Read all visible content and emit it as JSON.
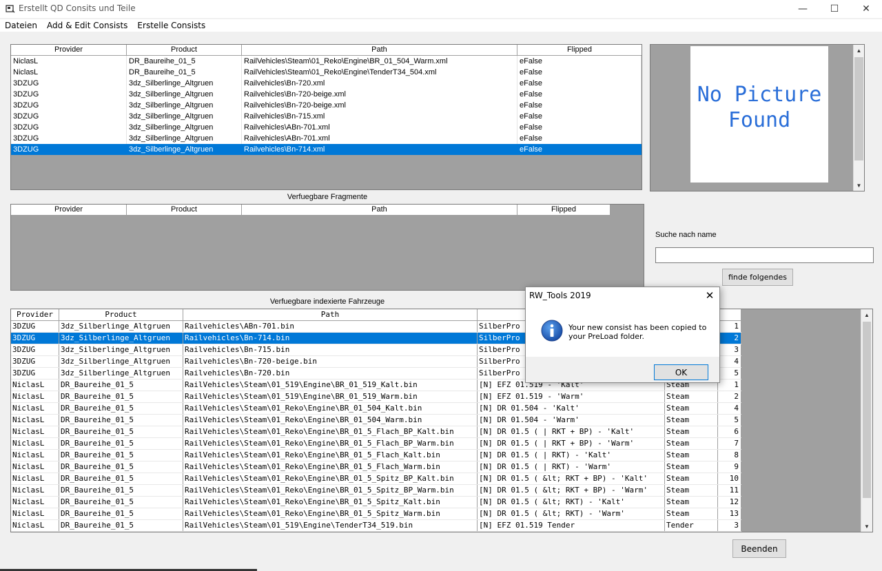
{
  "window": {
    "title": "Erstellt QD Consits und Teile",
    "minimize": "—",
    "maximize": "☐",
    "close": "✕"
  },
  "menu": [
    "Dateien",
    "Add & Edit Consists",
    "Erstelle Consists"
  ],
  "consist_table": {
    "headers": [
      "Provider",
      "Product",
      "Path",
      "Flipped"
    ],
    "rows": [
      [
        "NiclasL",
        "DR_Baureihe_01_5",
        "RailVehicles\\Steam\\01_Reko\\Engine\\BR_01_504_Warm.xml",
        "eFalse"
      ],
      [
        "NiclasL",
        "DR_Baureihe_01_5",
        "RailVehicles\\Steam\\01_Reko\\Engine\\TenderT34_504.xml",
        "eFalse"
      ],
      [
        "3DZUG",
        "3dz_Silberlinge_Altgruen",
        "Railvehicles\\Bn-720.xml",
        "eFalse"
      ],
      [
        "3DZUG",
        "3dz_Silberlinge_Altgruen",
        "Railvehicles\\Bn-720-beige.xml",
        "eFalse"
      ],
      [
        "3DZUG",
        "3dz_Silberlinge_Altgruen",
        "Railvehicles\\Bn-720-beige.xml",
        "eFalse"
      ],
      [
        "3DZUG",
        "3dz_Silberlinge_Altgruen",
        "Railvehicles\\Bn-715.xml",
        "eFalse"
      ],
      [
        "3DZUG",
        "3dz_Silberlinge_Altgruen",
        "Railvehicles\\ABn-701.xml",
        "eFalse"
      ],
      [
        "3DZUG",
        "3dz_Silberlinge_Altgruen",
        "Railvehicles\\ABn-701.xml",
        "eFalse"
      ],
      [
        "3DZUG",
        "3dz_Silberlinge_Altgruen",
        "Railvehicles\\Bn-714.xml",
        "eFalse"
      ]
    ],
    "selected_index": 8
  },
  "preview": {
    "line1": "No Picture",
    "line2": "Found"
  },
  "fragments": {
    "caption": "Verfuegbare Fragmente",
    "headers": [
      "Provider",
      "Product",
      "Path",
      "Flipped"
    ]
  },
  "search": {
    "label": "Suche nach name",
    "value": "",
    "button": "finde folgendes"
  },
  "vehicles": {
    "caption": "Verfuegbare indexierte Fahrzeuge",
    "headers": [
      "Provider",
      "Product",
      "Path"
    ],
    "rows": [
      [
        "3DZUG",
        "3dz_Silberlinge_Altgruen",
        "Railvehicles\\ABn-701.bin",
        "SilberPro",
        "",
        "1"
      ],
      [
        "3DZUG",
        "3dz_Silberlinge_Altgruen",
        "Railvehicles\\Bn-714.bin",
        "SilberPro",
        "",
        "2"
      ],
      [
        "3DZUG",
        "3dz_Silberlinge_Altgruen",
        "Railvehicles\\Bn-715.bin",
        "SilberPro",
        "",
        "3"
      ],
      [
        "3DZUG",
        "3dz_Silberlinge_Altgruen",
        "Railvehicles\\Bn-720-beige.bin",
        "SilberPro",
        "",
        "4"
      ],
      [
        "3DZUG",
        "3dz_Silberlinge_Altgruen",
        "Railvehicles\\Bn-720.bin",
        "SilberPro",
        "",
        "5"
      ],
      [
        "NiclasL",
        "DR_Baureihe_01_5",
        "RailVehicles\\Steam\\01_519\\Engine\\BR_01_519_Kalt.bin",
        "[N] EFZ 01.519 - 'Kalt'",
        "Steam",
        "1"
      ],
      [
        "NiclasL",
        "DR_Baureihe_01_5",
        "RailVehicles\\Steam\\01_519\\Engine\\BR_01_519_Warm.bin",
        "[N] EFZ 01.519 - 'Warm'",
        "Steam",
        "2"
      ],
      [
        "NiclasL",
        "DR_Baureihe_01_5",
        "RailVehicles\\Steam\\01_Reko\\Engine\\BR_01_504_Kalt.bin",
        "[N] DR 01.504 - 'Kalt'",
        "Steam",
        "4"
      ],
      [
        "NiclasL",
        "DR_Baureihe_01_5",
        "RailVehicles\\Steam\\01_Reko\\Engine\\BR_01_504_Warm.bin",
        "[N] DR 01.504 - 'Warm'",
        "Steam",
        "5"
      ],
      [
        "NiclasL",
        "DR_Baureihe_01_5",
        "RailVehicles\\Steam\\01_Reko\\Engine\\BR_01_5_Flach_BP_Kalt.bin",
        "[N] DR 01.5 ( | RKT + BP) - 'Kalt'",
        "Steam",
        "6"
      ],
      [
        "NiclasL",
        "DR_Baureihe_01_5",
        "RailVehicles\\Steam\\01_Reko\\Engine\\BR_01_5_Flach_BP_Warm.bin",
        "[N] DR 01.5 ( | RKT + BP) - 'Warm'",
        "Steam",
        "7"
      ],
      [
        "NiclasL",
        "DR_Baureihe_01_5",
        "RailVehicles\\Steam\\01_Reko\\Engine\\BR_01_5_Flach_Kalt.bin",
        "[N] DR 01.5 ( | RKT) - 'Kalt'",
        "Steam",
        "8"
      ],
      [
        "NiclasL",
        "DR_Baureihe_01_5",
        "RailVehicles\\Steam\\01_Reko\\Engine\\BR_01_5_Flach_Warm.bin",
        "[N] DR 01.5 ( | RKT) - 'Warm'",
        "Steam",
        "9"
      ],
      [
        "NiclasL",
        "DR_Baureihe_01_5",
        "RailVehicles\\Steam\\01_Reko\\Engine\\BR_01_5_Spitz_BP_Kalt.bin",
        "[N] DR 01.5 ( &lt; RKT + BP) - 'Kalt'",
        "Steam",
        "10"
      ],
      [
        "NiclasL",
        "DR_Baureihe_01_5",
        "RailVehicles\\Steam\\01_Reko\\Engine\\BR_01_5_Spitz_BP_Warm.bin",
        "[N] DR 01.5 ( &lt; RKT + BP) - 'Warm'",
        "Steam",
        "11"
      ],
      [
        "NiclasL",
        "DR_Baureihe_01_5",
        "RailVehicles\\Steam\\01_Reko\\Engine\\BR_01_5_Spitz_Kalt.bin",
        "[N] DR 01.5 ( &lt; RKT) - 'Kalt'",
        "Steam",
        "12"
      ],
      [
        "NiclasL",
        "DR_Baureihe_01_5",
        "RailVehicles\\Steam\\01_Reko\\Engine\\BR_01_5_Spitz_Warm.bin",
        "[N] DR 01.5 ( &lt; RKT) - 'Warm'",
        "Steam",
        "13"
      ],
      [
        "NiclasL",
        "DR_Baureihe_01_5",
        "RailVehicles\\Steam\\01_519\\Engine\\TenderT34_519.bin",
        "[N] EFZ 01.519 Tender",
        "Tender",
        "3"
      ]
    ],
    "selected_index": 1
  },
  "exit_button": "Beenden",
  "dialog": {
    "title": "RW_Tools 2019",
    "close": "✕",
    "message": "Your new consist has been copied to your PreLoad folder.",
    "ok": "OK"
  },
  "colors": {
    "selection": "#0078d7",
    "preview_text": "#2a6ed8"
  }
}
